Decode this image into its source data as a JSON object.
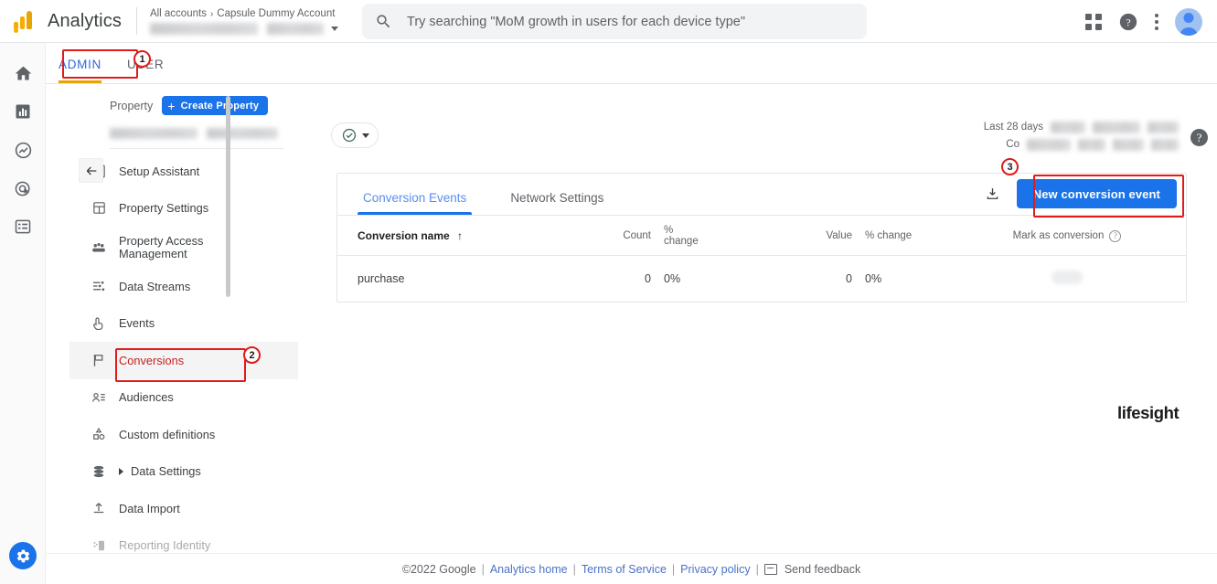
{
  "brand": {
    "name": "Analytics",
    "logo_icon": "analytics-logo-icon"
  },
  "header": {
    "breadcrumb_root": "All accounts",
    "breadcrumb_sep": "›",
    "breadcrumb_current": "Capsule Dummy Account",
    "account_selector_caret": "chevron-down-icon",
    "search": {
      "icon": "search-icon",
      "placeholder": "Try searching \"MoM growth in users for each device type\"",
      "value": ""
    },
    "actions": [
      {
        "name": "apps-grid-icon",
        "label": "Google apps"
      },
      {
        "name": "help-icon",
        "label": "Help"
      },
      {
        "name": "more-vert-icon",
        "label": "More options"
      },
      {
        "name": "account-avatar",
        "label": "Account"
      }
    ]
  },
  "admin_tabs": [
    {
      "label": "ADMIN",
      "selected": true
    },
    {
      "label": "USER",
      "selected": false
    }
  ],
  "rail": {
    "items": [
      {
        "name": "home-icon",
        "label": "Home"
      },
      {
        "name": "reports-icon",
        "label": "Reports"
      },
      {
        "name": "explore-icon",
        "label": "Explore"
      },
      {
        "name": "advertising-icon",
        "label": "Advertising"
      },
      {
        "name": "configure-icon",
        "label": "Configure"
      }
    ],
    "gear": {
      "name": "gear-icon",
      "label": "Admin"
    }
  },
  "property_panel": {
    "label": "Property",
    "create_button": "Create Property",
    "create_button_icon": "plus-icon",
    "back_icon": "arrow-back-icon",
    "menu": [
      {
        "label": "Setup Assistant",
        "icon": "checklist-icon",
        "active": false,
        "expandable": false
      },
      {
        "label": "Property Settings",
        "icon": "property-settings-icon",
        "active": false,
        "expandable": false
      },
      {
        "label": "Property Access Management",
        "icon": "people-icon",
        "active": false,
        "expandable": false
      },
      {
        "label": "Data Streams",
        "icon": "data-streams-icon",
        "active": false,
        "expandable": false
      },
      {
        "label": "Events",
        "icon": "events-icon",
        "active": false,
        "expandable": false
      },
      {
        "label": "Conversions",
        "icon": "flag-icon",
        "active": true,
        "expandable": false
      },
      {
        "label": "Audiences",
        "icon": "audiences-icon",
        "active": false,
        "expandable": false
      },
      {
        "label": "Custom definitions",
        "icon": "custom-definitions-icon",
        "active": false,
        "expandable": false
      },
      {
        "label": "Data Settings",
        "icon": "database-icon",
        "active": false,
        "expandable": true
      },
      {
        "label": "Data Import",
        "icon": "upload-icon",
        "active": false,
        "expandable": false
      },
      {
        "label": "Reporting Identity",
        "icon": "reporting-identity-icon",
        "active": false,
        "expandable": false
      }
    ]
  },
  "main": {
    "status_pill": {
      "icon": "check-circle-icon",
      "caret": "chevron-down-icon"
    },
    "date_range": {
      "primary_label": "Last 28 days",
      "compare_label": "Co",
      "help_icon": "help-icon"
    },
    "card": {
      "tabs": [
        {
          "label": "Conversion Events",
          "selected": true
        },
        {
          "label": "Network Settings",
          "selected": false
        }
      ],
      "download_icon": "download-icon",
      "primary_button": "New conversion event",
      "table": {
        "columns": [
          "Conversion name",
          "Count",
          "% change",
          "Value",
          "% change",
          "Mark as conversion"
        ],
        "sort_icon": "arrow-up-icon",
        "mark_help_icon": "help-icon",
        "rows": [
          {
            "name": "purchase",
            "count": "0",
            "count_change": "0%",
            "value": "0",
            "value_change": "0%",
            "mark_as_conversion": "toggle-off"
          }
        ]
      }
    },
    "watermark": "lifesight"
  },
  "footer": {
    "copyright": "©2022 Google",
    "links": [
      {
        "label": "Analytics home"
      },
      {
        "label": "Terms of Service"
      },
      {
        "label": "Privacy policy"
      }
    ],
    "feedback": {
      "icon": "feedback-icon",
      "label": "Send feedback"
    },
    "separator": "|"
  },
  "annotations": [
    {
      "number": "1",
      "target": "ADMIN tab"
    },
    {
      "number": "2",
      "target": "Conversions menu item"
    },
    {
      "number": "3",
      "target": "New conversion event button"
    }
  ],
  "colors": {
    "google_blue": "#1a73e8",
    "accent_yellow": "#e8a400",
    "annotation_red": "#e01b1b",
    "active_menu_red": "#c5221f",
    "link_blue": "#4a72c4"
  }
}
